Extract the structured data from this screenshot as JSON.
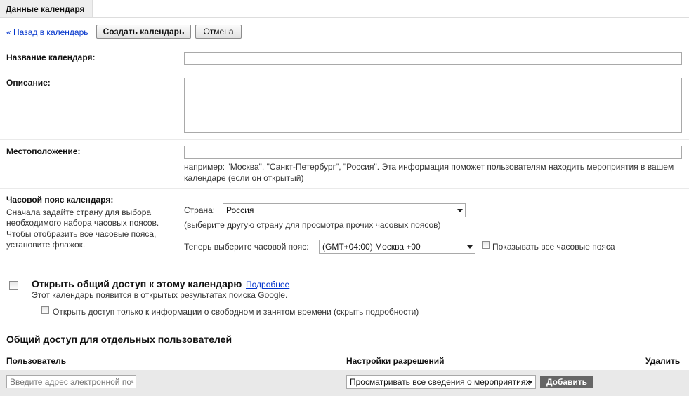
{
  "header": {
    "tab_title": "Данные календаря"
  },
  "toolbar": {
    "back_link": "« Назад в календарь",
    "create_button": "Создать календарь",
    "cancel_button": "Отмена"
  },
  "form": {
    "name": {
      "label": "Название календаря:",
      "value": ""
    },
    "description": {
      "label": "Описание:",
      "value": ""
    },
    "location": {
      "label": "Местоположение:",
      "value": "",
      "hint_line1": "например: \"Москва\", \"Санкт-Петербург\", \"Россия\". Эта информация поможет пользователям находить мероприятия в вашем",
      "hint_line2": "календаре (если он открытый)"
    },
    "timezone": {
      "label": "Часовой пояс календаря:",
      "desc_line1": "Сначала задайте страну для выбора",
      "desc_line2": "необходимого набора часовых поясов.",
      "desc_line3": "Чтобы отобразить все часовые пояса,",
      "desc_line4": "установите флажок.",
      "country_label": "Страна:",
      "country_value": "Россия",
      "country_hint": "(выберите другую страну для просмотра прочих часовых поясов)",
      "tz_label": "Теперь выберите часовой пояс:",
      "tz_value": "(GMT+04:00) Москва +00",
      "show_all_label": "Показывать все часовые пояса"
    }
  },
  "sharing": {
    "public_title": "Открыть общий доступ к этому календарю",
    "more_link": "Подробнее",
    "public_note": "Этот календарь появится в открытых результатах поиска Google.",
    "freebusy_label": "Открыть доступ только к информации о свободном и занятом времени (скрыть подробности)",
    "individual_title": "Общий доступ для отдельных пользователей",
    "col_user": "Пользователь",
    "col_permissions": "Настройки разрешений",
    "col_delete": "Удалить",
    "email_placeholder": "Введите адрес электронной почты",
    "permission_value": "Просматривать все сведения о мероприятиях",
    "add_button": "Добавить"
  }
}
